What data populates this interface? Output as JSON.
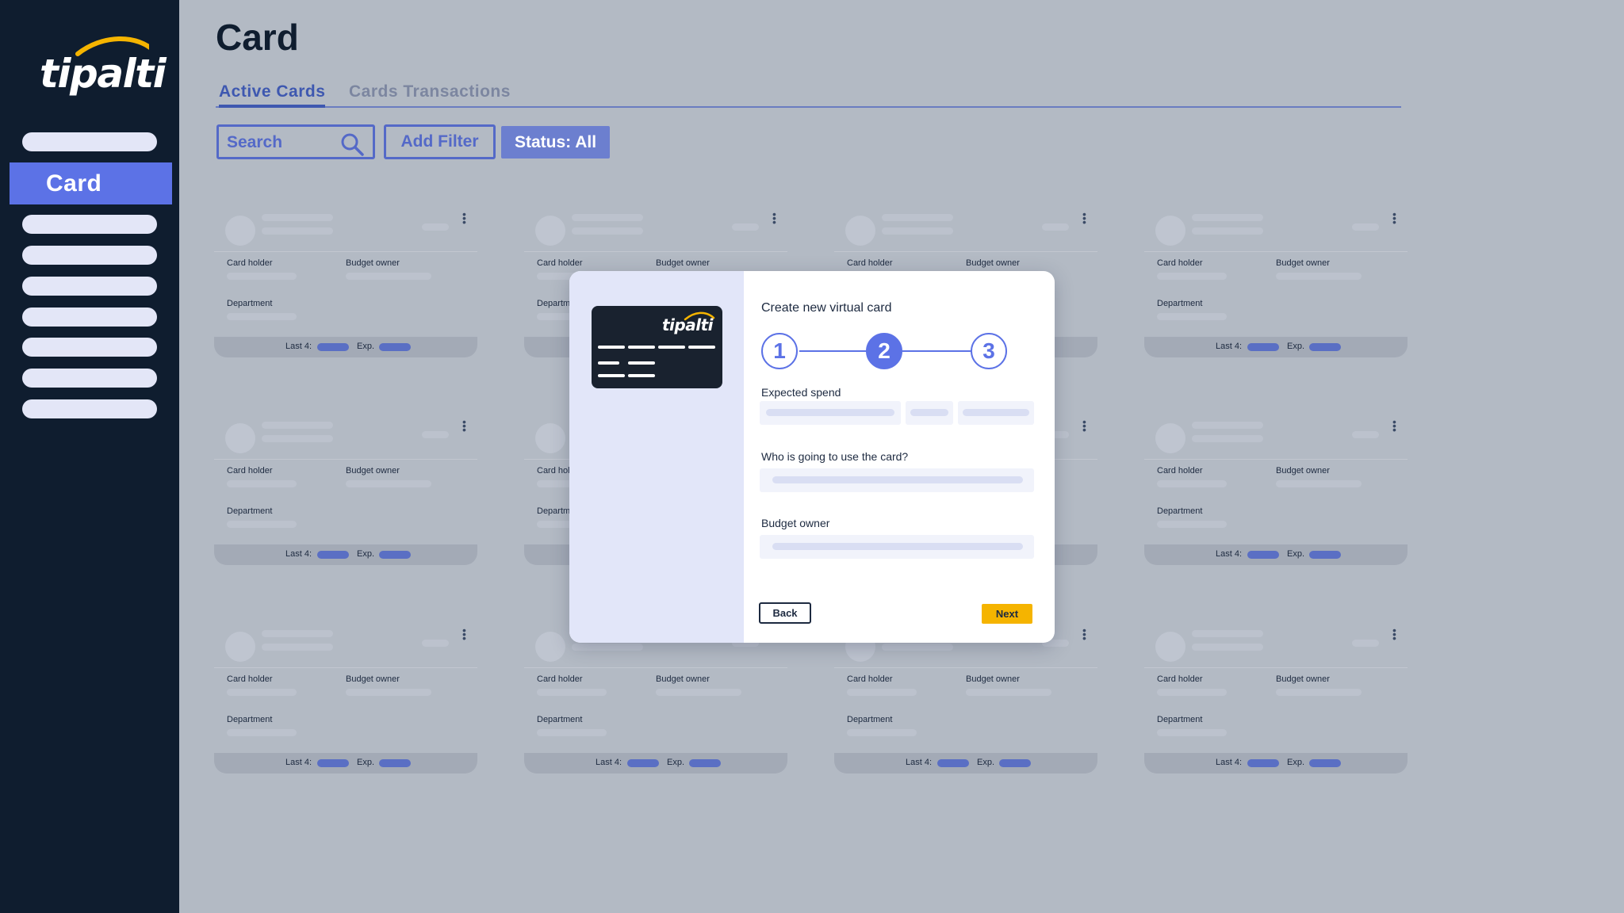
{
  "app": {
    "logo_text": "tipalti",
    "brand_color": "#5c72e6",
    "sidebar_color": "#0f1d2f",
    "accent_yellow": "#f5b400"
  },
  "sidebar": {
    "active_item": "Card"
  },
  "page": {
    "title": "Card",
    "tabs": [
      {
        "label": "Active Cards",
        "active": true
      },
      {
        "label": "Cards Transactions",
        "active": false
      }
    ]
  },
  "toolbar": {
    "search_placeholder": "Search",
    "search_icon": "search-icon",
    "add_filter_label": "Add Filter",
    "status_label": "Status: All"
  },
  "card_labels": {
    "card_holder": "Card holder",
    "budget_owner": "Budget owner",
    "department": "Department",
    "last4": "Last 4:",
    "exp": "Exp."
  },
  "modal": {
    "title": "Create new virtual card",
    "card_logo": "tipalti",
    "steps": [
      "1",
      "2",
      "3"
    ],
    "current_step": 2,
    "expected_spend_label": "Expected spend",
    "who_label": "Who is going to use the card?",
    "budget_owner_label": "Budget owner",
    "back_label": "Back",
    "next_label": "Next"
  }
}
